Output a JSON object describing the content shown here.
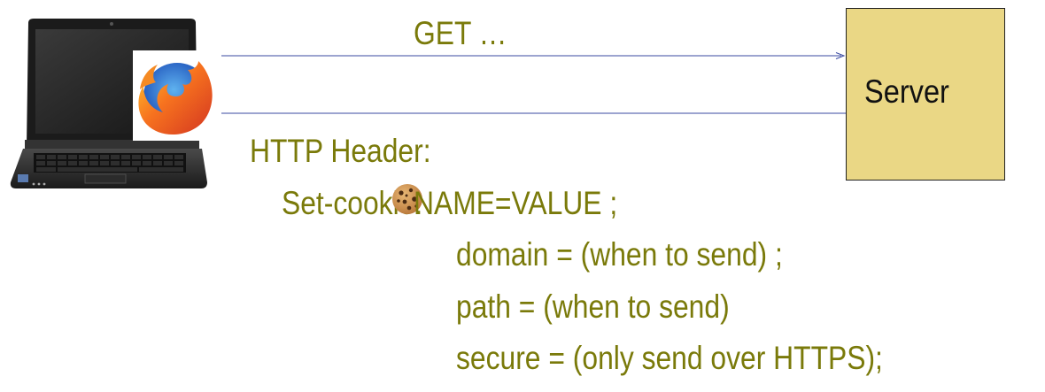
{
  "request": {
    "label": "GET …"
  },
  "server": {
    "label": "Server"
  },
  "response": {
    "header_label": "HTTP Header:",
    "set_cookie_prefix": "Set-cookie:",
    "name_value": "NAME=VALUE ;",
    "domain_line": "domain = (when to send) ;",
    "path_line": "path = (when to send)",
    "secure_line": "secure = (only send over HTTPS);"
  },
  "icons": {
    "client": "laptop-icon",
    "browser": "firefox-icon",
    "cookie": "cookie-icon"
  },
  "colors": {
    "text": "#7a7a0a",
    "server_fill": "#ead785",
    "arrow": "#3a4aa0"
  }
}
